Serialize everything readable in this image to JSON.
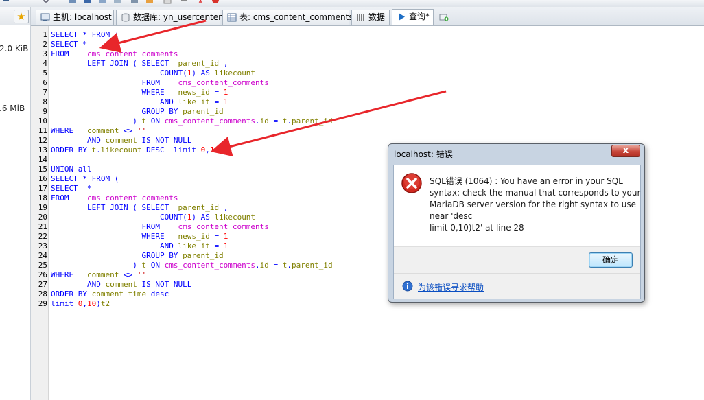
{
  "left_panel": {
    "sizes": [
      "2.0 KiB",
      ".6 MiB"
    ]
  },
  "tabs": [
    {
      "label": "主机: localhost",
      "icon": "server-icon"
    },
    {
      "label": "数据库: yn_usercenter",
      "icon": "database-icon"
    },
    {
      "label": "表: cms_content_comments",
      "icon": "table-icon"
    },
    {
      "label": "数据",
      "icon": "data-grid-icon"
    },
    {
      "label": "查询*",
      "icon": "play-icon"
    }
  ],
  "editor": {
    "line_numbers": [
      "1",
      "2",
      "3",
      "4",
      "5",
      "6",
      "7",
      "8",
      "9",
      "10",
      "11",
      "12",
      "13",
      "14",
      "15",
      "16",
      "17",
      "18",
      "19",
      "20",
      "21",
      "22",
      "23",
      "24",
      "25",
      "26",
      "27",
      "28",
      "29"
    ]
  },
  "dialog": {
    "title": "localhost: 错误",
    "close_label": "x",
    "message_lines": [
      "SQL错误 (1064) : You have an error in your SQL",
      "syntax; check the manual that corresponds to your",
      "MariaDB server version for the right syntax to use",
      "near 'desc",
      "limit 0,10)t2' at line 28"
    ],
    "ok_label": "确定",
    "help_link": "为该错误寻求帮助"
  },
  "colors": {
    "keyword": "#0000ff",
    "table": "#cc00cc",
    "field": "#808000",
    "number": "#ff0000",
    "arrow": "#e8262b"
  }
}
